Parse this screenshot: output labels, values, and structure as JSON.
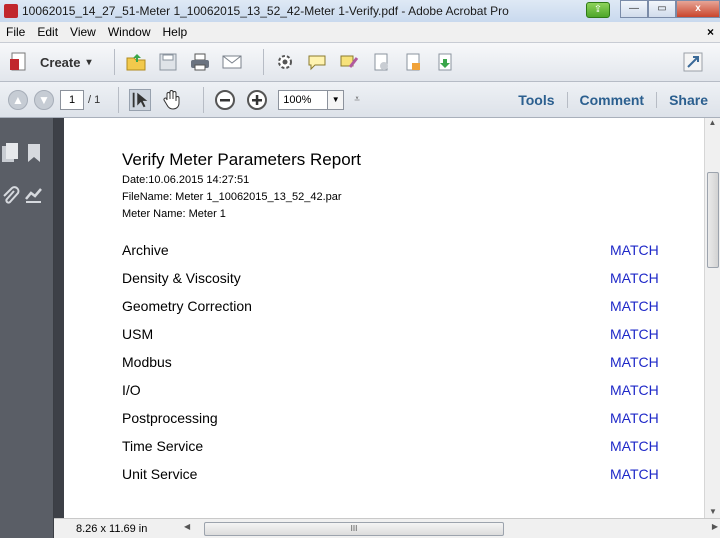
{
  "window": {
    "title": "10062015_14_27_51-Meter 1_10062015_13_52_42-Meter 1-Verify.pdf - Adobe Acrobat Pro",
    "close_glyph": "x"
  },
  "menu": [
    "File",
    "Edit",
    "View",
    "Window",
    "Help"
  ],
  "menu_close": "×",
  "toolbar": {
    "create_label": "Create",
    "create_dropdown": "▾",
    "icons": [
      "open-folder-icon",
      "save-icon",
      "print-icon",
      "email-icon",
      "settings-icon",
      "comment-icon",
      "highlight-icon",
      "pdf-combine-icon",
      "pdf-export-icon",
      "pdf-share-icon"
    ]
  },
  "nav": {
    "page_current": "1",
    "page_total": "/ 1",
    "zoom": "100%",
    "tools": "Tools",
    "comment": "Comment",
    "share": "Share"
  },
  "report": {
    "title": "Verify Meter Parameters Report",
    "date": "Date:10.06.2015 14:27:51",
    "filename": "FileName: Meter 1_10062015_13_52_42.par",
    "metername": "Meter Name: Meter 1",
    "rows": [
      {
        "name": "Archive",
        "status": "MATCH"
      },
      {
        "name": "Density & Viscosity",
        "status": "MATCH"
      },
      {
        "name": "Geometry Correction",
        "status": "MATCH"
      },
      {
        "name": "USM",
        "status": "MATCH"
      },
      {
        "name": "Modbus",
        "status": "MATCH"
      },
      {
        "name": "I/O",
        "status": "MATCH"
      },
      {
        "name": "Postprocessing",
        "status": "MATCH"
      },
      {
        "name": "Time Service",
        "status": "MATCH"
      },
      {
        "name": "Unit Service",
        "status": "MATCH"
      }
    ]
  },
  "status": {
    "page_size": "8.26 x 11.69 in",
    "hscroll_grip": "III"
  },
  "colors": {
    "match": "#1e28c8",
    "nav_text": "#2b5f8f"
  }
}
